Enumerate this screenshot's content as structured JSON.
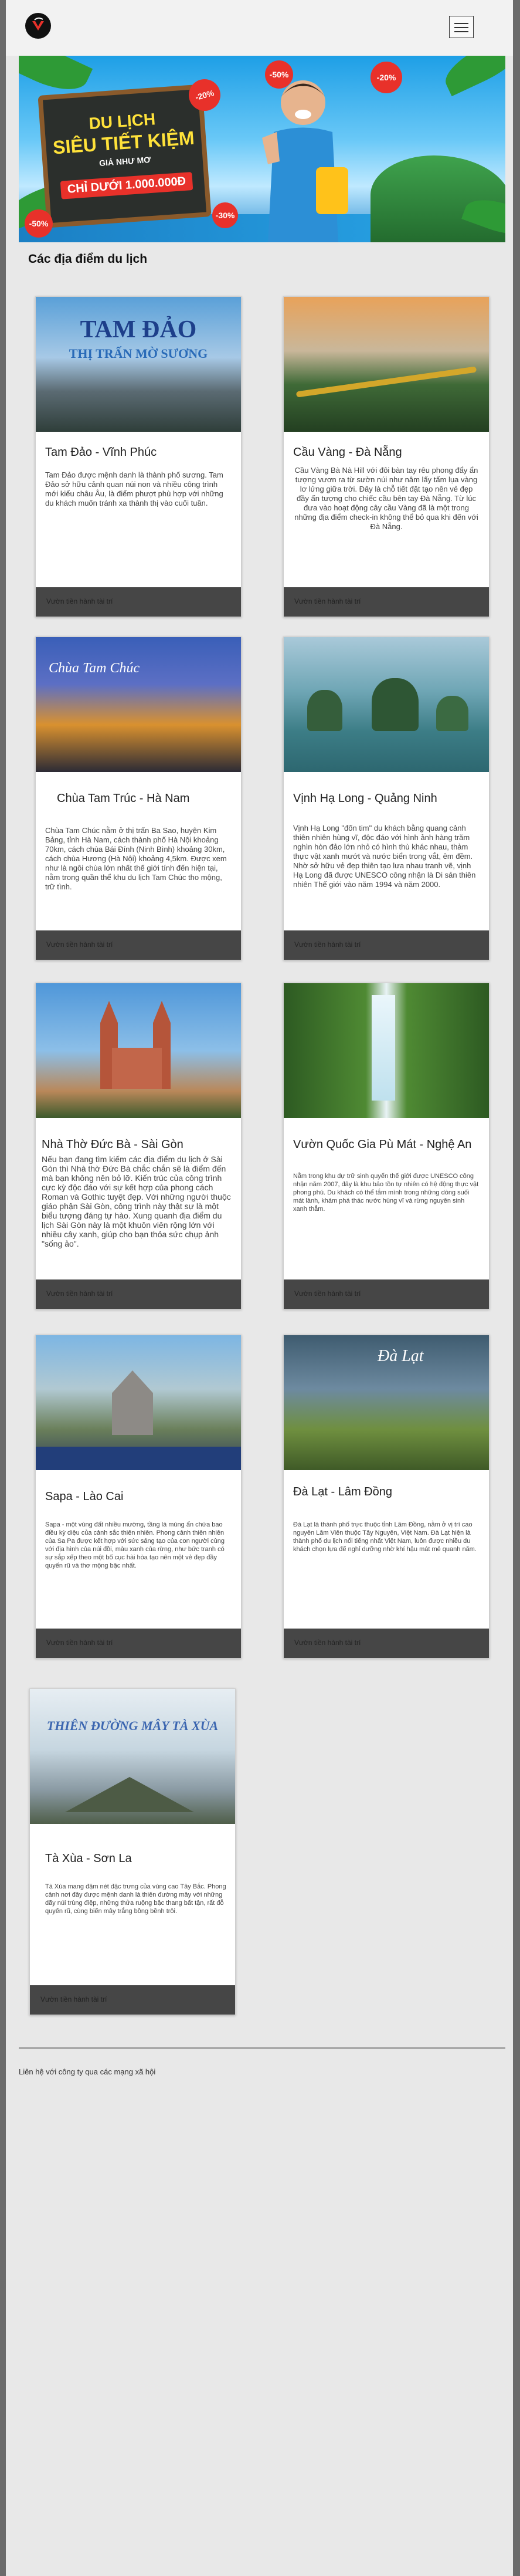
{
  "header": {
    "logo_icon": "travel-logo-icon",
    "menu_icon": "hamburger-menu-icon"
  },
  "banner": {
    "line1": "DU LỊCH",
    "line2": "SIÊU TIẾT KIỆM",
    "line3": "GIÁ NHƯ MƠ",
    "price": "CHỈ DƯỚI 1.000.000Đ",
    "badges": [
      "-20%",
      "-30%",
      "-50%",
      "-20%",
      "-50%"
    ]
  },
  "section": {
    "title": "Các địa điểm du lịch"
  },
  "cards": [
    {
      "img_text": "TAM ĐẢO",
      "img_subtext": "THỊ TRẤN MỜ SƯƠNG",
      "title": "Tam Đảo - Vĩnh Phúc",
      "desc": "Tam Đảo được mệnh danh là thành phố sương. Tam Đảo sở hữu cảnh quan núi non và nhiều công trình mới kiểu châu Âu, là điểm phượt phù hợp với những du khách muốn tránh xa thành thị vào cuối tuần.",
      "link": "Vườn tiền hành tài trí"
    },
    {
      "img_text": "",
      "img_subtext": "",
      "title": "Cầu Vàng - Đà Nẵng",
      "desc": "Cầu Vàng Bà Nà Hill với đôi bàn tay rêu phong đẩy ẩn tượng vươn ra từ sườn núi như nâm lấy tấm lụa vàng lơ lửng giữa trời. Đây là chỗ tiết đặt tạo nên vẻ đẹp đầy ấn tượng cho chiếc cầu bên tay Đà Nẵng. Từ lúc đưa vào hoạt động cây cầu Vàng đã là một trong những địa điểm check-in không thể bỏ qua khi đến với Đà Nẵng.",
      "link": "Vườn tiền hành tài trí"
    },
    {
      "img_text": "Chùa Tam Chúc",
      "img_subtext": "",
      "title": "Chùa Tam Trúc - Hà Nam",
      "desc": "Chùa Tam Chúc nằm ở thị trấn Ba Sao, huyện Kim Bảng, tỉnh Hà Nam, cách thành phố Hà Nội khoảng 70km, cách chùa Bái Đính (Ninh Bình) khoảng 30km, cách chùa Hương (Hà Nội) khoảng 4,5km. Được xem như là ngôi chùa lớn nhất thế giới tính đến hiện tại, nằm trong quần thể khu du lịch Tam Chúc tho mộng, trữ tình.",
      "link": "Vườn tiền hành tài trí"
    },
    {
      "img_text": "",
      "img_subtext": "",
      "title": "Vịnh Hạ Long - Quảng Ninh",
      "desc": "Vịnh Hạ Long \"đốn tim\" du khách bằng quang cảnh thiên nhiên hùng vĩ, độc đáo với hình ảnh hàng trăm nghìn hòn đảo lớn nhỏ có hình thù khác nhau, thảm thực vật xanh mướt và nước biển trong vắt, êm đềm. Nhờ sở hữu vẻ đẹp thiên tạo lưa nhau tranh vẽ, vịnh Hạ Long đã được UNESCO công nhận là Di sản thiên nhiên Thế giới vào năm 1994 và năm 2000.",
      "link": "Vườn tiền hành tài trí"
    },
    {
      "img_text": "",
      "img_subtext": "",
      "title": "Nhà Thờ Đức Bà - Sài Gòn",
      "desc": "Nếu bạn đang tìm kiếm các địa điểm du lịch ở Sài Gòn thì Nhà thờ Đức Bà chắc chắn sẽ là điểm đến mà bạn không nên bỏ lỡ. Kiến trúc của công trình cực kỳ độc đáo với sự kết hợp của phong cách Roman và Gothic tuyệt đẹp. Với những người thuộc giáo phận Sài Gòn, công trình này thật sự là một biểu tượng đáng tự hào. Xung quanh địa điểm du lịch Sài Gòn này là một khuôn viên rộng lớn với nhiều cây xanh, giúp cho bạn thỏa sức chụp ảnh \"sống ảo\".",
      "link": "Vườn tiền hành tài trí"
    },
    {
      "img_text": "",
      "img_subtext": "",
      "title": "Vườn Quốc Gia Pù Mát - Nghệ An",
      "desc": "Nằm trong khu dự trữ sinh quyển thế giới được UNESCO công nhận năm 2007, đây là khu bảo tồn tự nhiên có hệ động thực vật phong phú. Du khách có thể tắm mình trong những dòng suối mát lành, khám phá thác nước hùng vĩ và rừng nguyên sinh xanh thẳm.",
      "link": "Vườn tiền hành tài trí"
    },
    {
      "img_text": "",
      "img_subtext": "",
      "title": "Sapa - Lào Cai",
      "desc": "Sapa - một vùng đất nhiều mường, tầng lá mùng ẩn chứa bao điều kỳ diệu của cảnh sắc thiên nhiên. Phong cảnh thiên nhiên của Sa Pa được kết hợp với sức sáng tạo của con người cùng với địa hình của núi đồi, màu xanh của rừng, như bức tranh có sự sắp xếp theo một bố cục hài hòa tạo nên một vẻ đẹp đầy quyến rũ và thơ mộng bậc nhất.",
      "link": "Vườn tiền hành tài trí"
    },
    {
      "img_text": "Đà Lạt",
      "img_subtext": "",
      "title": "Đà Lạt - Lâm Đồng",
      "desc": "Đà Lạt là thành phố trực thuộc tỉnh Lâm Đồng, nằm ở vị trí cao nguyên Lâm Viên thuộc Tây Nguyên, Việt Nam. Đà Lạt hiện là thành phố du lịch nổi tiếng nhất Việt Nam, luôn được nhiều du khách chọn lựa để nghỉ dưỡng nhờ khí hậu mát mẻ quanh năm.",
      "link": "Vườn tiền hành tài trí"
    },
    {
      "img_text": "THIÊN ĐƯỜNG MÂY TÀ XÙA",
      "img_subtext": "",
      "title": "Tà Xùa - Sơn La",
      "desc": "Tà Xùa mang đậm nét đặc trưng của vùng cao Tây Bắc. Phong cảnh nơi đây được mệnh danh là thiên đường mây với những dãy núi trùng điệp, những thửa ruộng bậc thang bất tận, rất đỗ quyến rũ, cùng biển mây trắng bồng bềnh trôi.",
      "link": "Vườn tiền hành tài trí"
    }
  ],
  "footer": {
    "text": "Liên hệ với công ty qua các mạng xã hội"
  }
}
